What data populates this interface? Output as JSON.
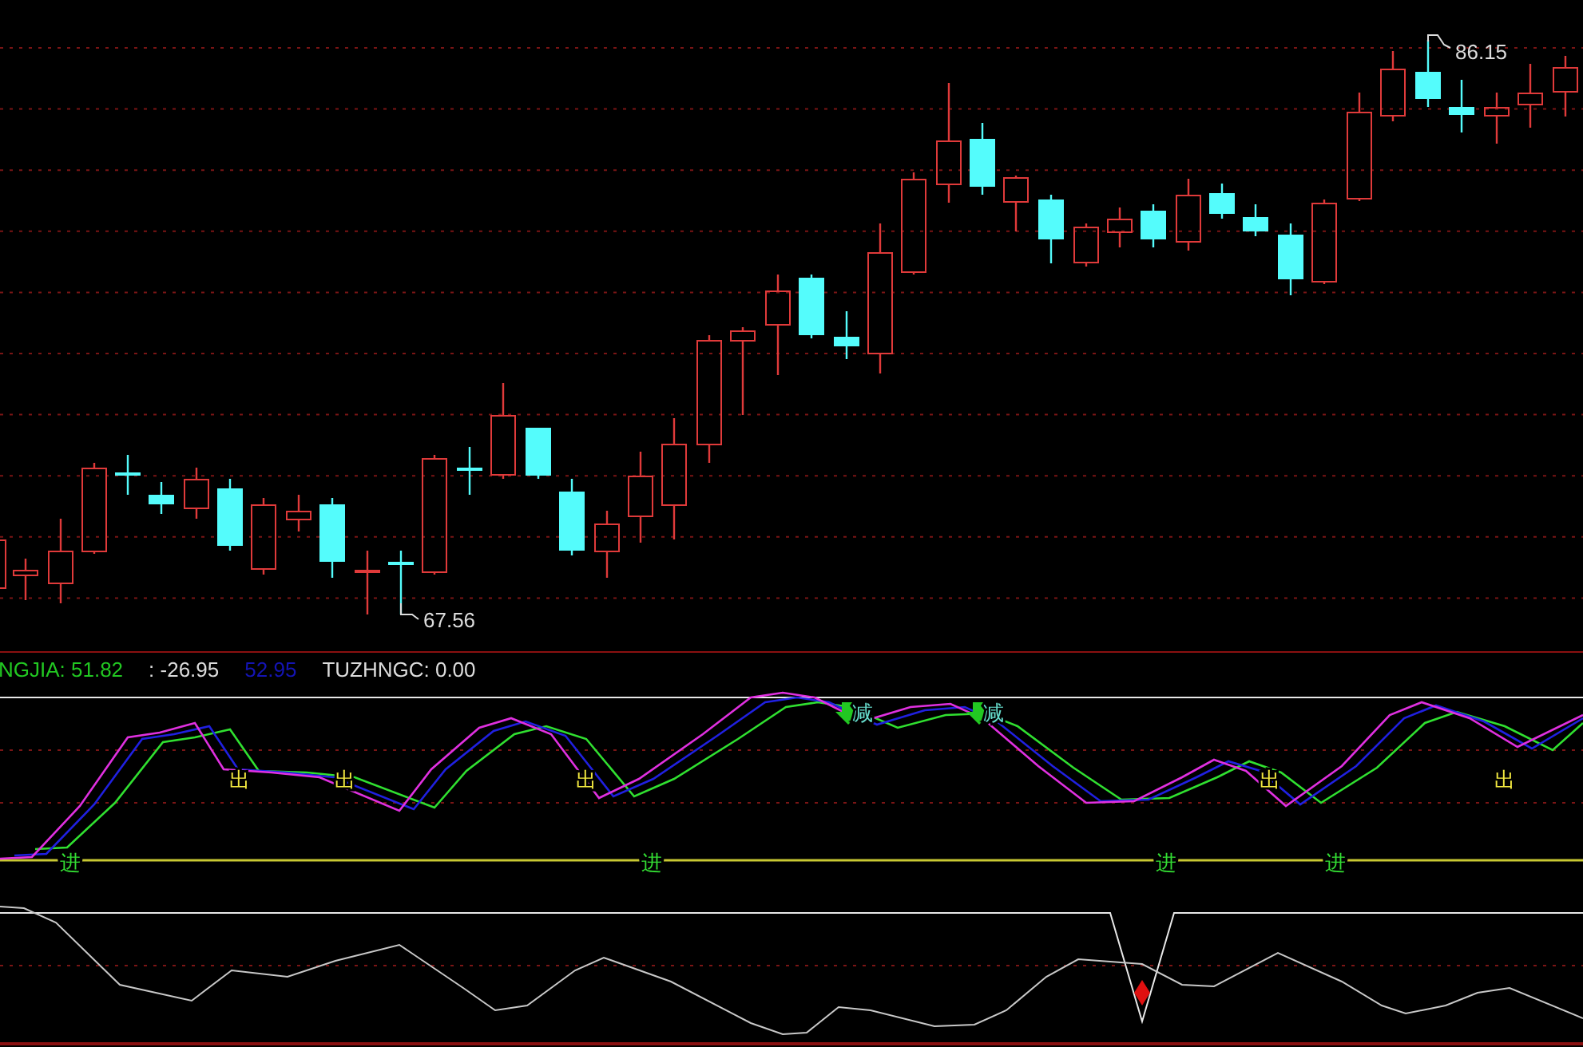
{
  "price_chart": {
    "high_label": "86.15",
    "low_label": "67.56"
  },
  "indicator_header": [
    {
      "text": "NGJIA: 51.82",
      "color": "#22c822"
    },
    {
      "text": ": -26.95",
      "color": "#dcdcdc"
    },
    {
      "text": "52.95",
      "color": "#1414b4"
    },
    {
      "text": "TUZHNGC: 0.00",
      "color": "#dcdcdc"
    }
  ],
  "signals": [
    {
      "text": "进",
      "kind": "enter"
    },
    {
      "text": "出",
      "kind": "exit"
    },
    {
      "text": "出",
      "kind": "exit"
    },
    {
      "text": "出",
      "kind": "exit"
    },
    {
      "text": "进",
      "kind": "enter"
    },
    {
      "text": "减",
      "kind": "reduce"
    },
    {
      "text": "减",
      "kind": "reduce"
    },
    {
      "text": "进",
      "kind": "enter"
    },
    {
      "text": "出",
      "kind": "exit"
    },
    {
      "text": "进",
      "kind": "enter"
    },
    {
      "text": "出",
      "kind": "exit"
    }
  ]
}
